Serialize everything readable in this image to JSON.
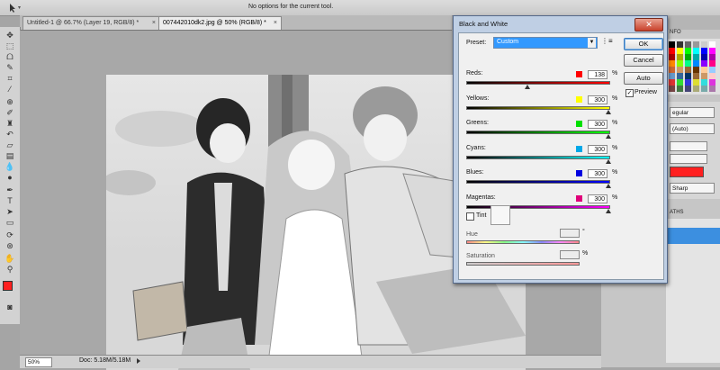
{
  "options_bar": {
    "message": "No options for the current tool."
  },
  "tabs": [
    {
      "label": "Untitled-1 @ 66.7% (Layer 19, RGB/8) *",
      "close": "×"
    },
    {
      "label": "007442010dk2.jpg @ 50% (RGB/8) *",
      "close": "×"
    }
  ],
  "status": {
    "zoom": "50%",
    "doc": "Doc: 5.18M/5.18M"
  },
  "dialog": {
    "title": "Black and White",
    "close_glyph": "✕",
    "preset_label": "Preset:",
    "preset_value": "Custom",
    "sliders": [
      {
        "label": "Reds:",
        "value": "138",
        "unit": "%",
        "swatch": "#ff0000",
        "gradient": [
          "#000000",
          "#ff0000"
        ],
        "level": 0.42
      },
      {
        "label": "Yellows:",
        "value": "300",
        "unit": "%",
        "swatch": "#ffff00",
        "gradient": [
          "#000000",
          "#ffff00"
        ],
        "level": 1.0
      },
      {
        "label": "Greens:",
        "value": "300",
        "unit": "%",
        "swatch": "#00e000",
        "gradient": [
          "#000000",
          "#00ff00"
        ],
        "level": 1.0
      },
      {
        "label": "Cyans:",
        "value": "300",
        "unit": "%",
        "swatch": "#00a8e8",
        "gradient": [
          "#000000",
          "#00ffff"
        ],
        "level": 1.0
      },
      {
        "label": "Blues:",
        "value": "300",
        "unit": "%",
        "swatch": "#0000e0",
        "gradient": [
          "#000000",
          "#0000ff"
        ],
        "level": 1.0
      },
      {
        "label": "Magentas:",
        "value": "300",
        "unit": "%",
        "swatch": "#e0007a",
        "gradient": [
          "#000000",
          "#ff00ff"
        ],
        "level": 1.0
      }
    ],
    "tint_label": "Tint",
    "hue_label": "Hue",
    "hue_unit": "°",
    "saturation_label": "Saturation",
    "saturation_unit": "%",
    "buttons": {
      "ok": "OK",
      "cancel": "Cancel",
      "auto": "Auto"
    },
    "preview_label": "Preview",
    "preview_checked": true
  },
  "right_panel": {
    "fragments": {
      "info": "NFO",
      "char_style": "egular",
      "char_auto": "(Auto)",
      "char_sharp": "Sharp",
      "paths": "ATHS"
    },
    "foreground_color": "#ff2020"
  },
  "colors": {
    "dialog_frame": "#bfcfe4",
    "accent_blue": "#3399ff",
    "selected_layer": "#3c8fe0"
  }
}
